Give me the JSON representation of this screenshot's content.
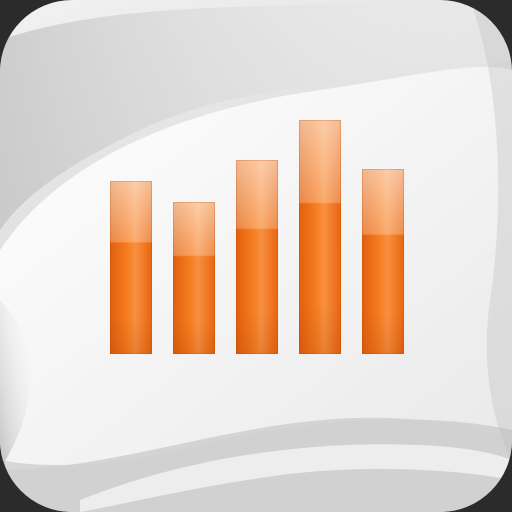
{
  "icon": {
    "name": "chart-app-icon",
    "accent_color": "#f57c1f",
    "background_color": "#e6e6e6"
  },
  "bar_chart_glyph": {
    "name": "bar-chart-icon",
    "bar_levels": [
      0.74,
      0.65,
      0.83,
      1.0,
      0.79
    ]
  }
}
